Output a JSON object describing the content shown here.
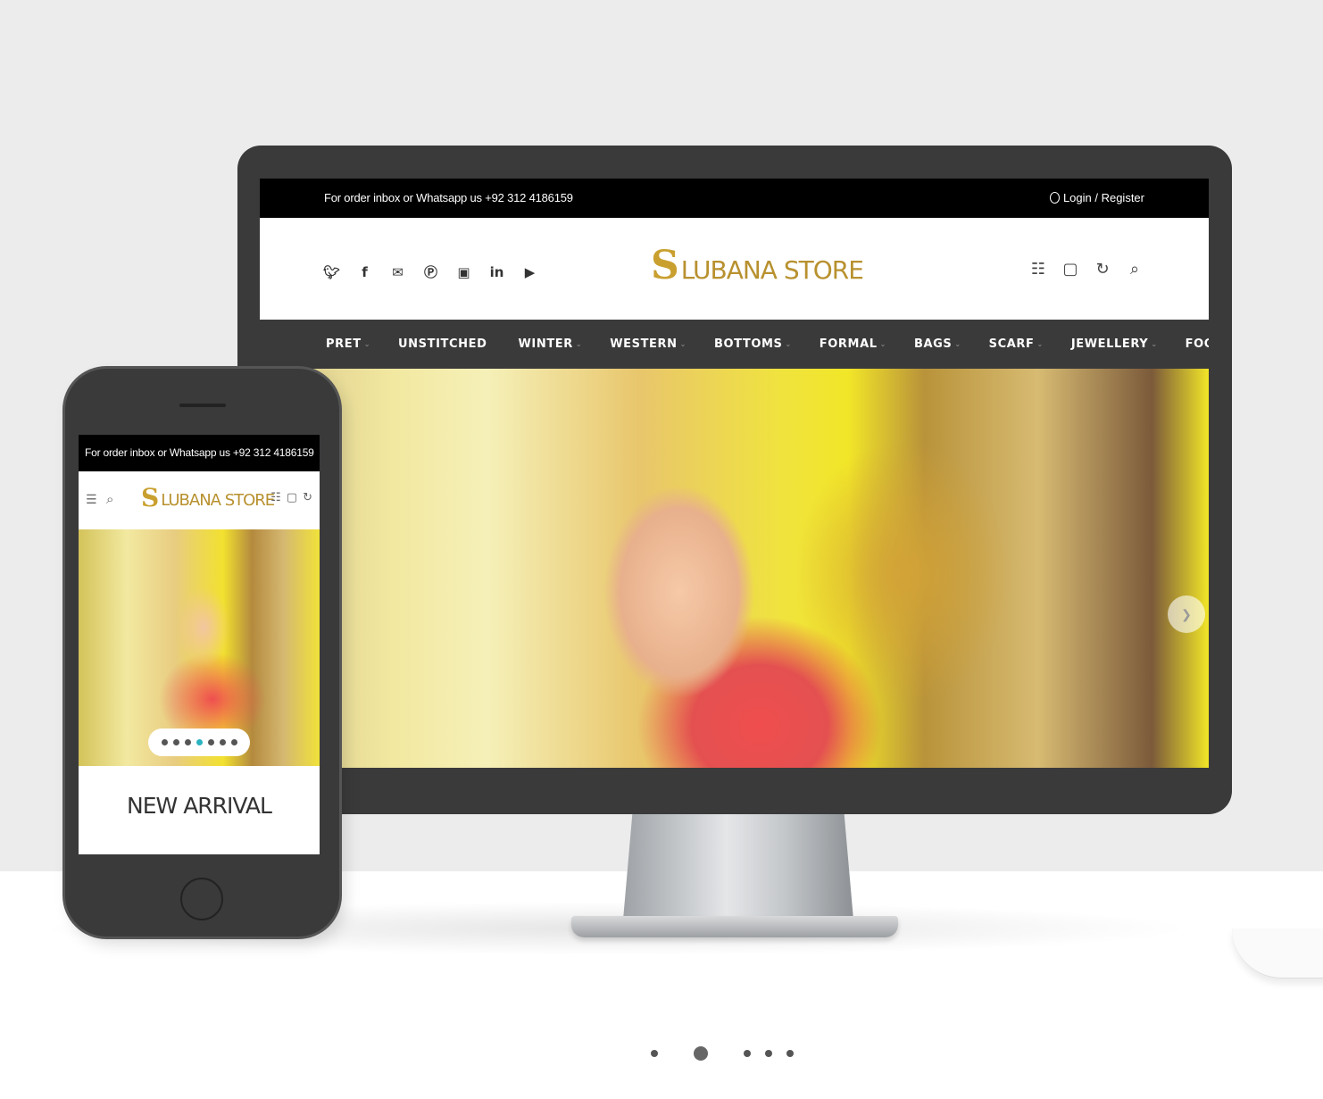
{
  "desktop": {
    "topbar": {
      "message": "For order inbox or Whatsapp us +92 312 4186159",
      "login_label": "Login / Register"
    },
    "social_icons": [
      "twitter-icon",
      "facebook-icon",
      "mail-icon",
      "pinterest-icon",
      "instagram-icon",
      "linkedin-icon",
      "youtube-icon"
    ],
    "logo": {
      "mark": "S",
      "text": "LUBANA STORE"
    },
    "header_icons": [
      "grid-icon",
      "bag-icon",
      "refresh-icon",
      "search-icon"
    ],
    "nav": [
      {
        "label": "PRET",
        "has_dropdown": true
      },
      {
        "label": "UNSTITCHED",
        "has_dropdown": false
      },
      {
        "label": "WINTER",
        "has_dropdown": true
      },
      {
        "label": "WESTERN",
        "has_dropdown": true
      },
      {
        "label": "BOTTOMS",
        "has_dropdown": true
      },
      {
        "label": "FORMAL",
        "has_dropdown": true
      },
      {
        "label": "BAGS",
        "has_dropdown": true
      },
      {
        "label": "SCARF",
        "has_dropdown": true
      },
      {
        "label": "JEWELLERY",
        "has_dropdown": true
      },
      {
        "label": "FOOTWEAR",
        "has_dropdown": true
      }
    ]
  },
  "mobile": {
    "topbar_message": "For order inbox or Whatsapp us +92 312 4186159",
    "logo": {
      "mark": "S",
      "text": "LUBANA STORE"
    },
    "slider_dots": {
      "count": 7,
      "active_index": 3
    },
    "section_title": "NEW ARRIVAL"
  },
  "carousel": {
    "count": 5,
    "active_index": 1
  },
  "colors": {
    "gold": "#b8912f",
    "dark": "#3a3a3b",
    "accent": "#2bb3c2"
  }
}
